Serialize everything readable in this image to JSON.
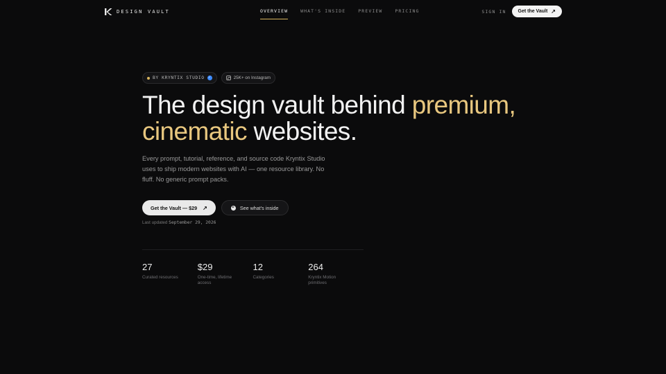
{
  "nav": {
    "brand": "DESIGN VAULT",
    "links": [
      "OVERVIEW",
      "WHAT'S INSIDE",
      "PREVIEW",
      "PRICING"
    ],
    "active_link": "OVERVIEW",
    "signin": "SIGN IN",
    "cta": "Get the Vault"
  },
  "hero": {
    "badge_studio": "BY KRYNTIX STUDIO",
    "badge_instagram": "25K+ on Instagram",
    "headline_part1": "The design vault behind ",
    "headline_gold1": "premium,",
    "headline_gold2": "cinematic",
    "headline_part2": " websites.",
    "description": "Every prompt, tutorial, reference, and source code Kryntix Studio uses to ship modern websites with AI — one resource library. No fluff. No generic prompt packs.",
    "primary_button": "Get the Vault — $29",
    "secondary_button": "See what's inside",
    "updated_label": "Last updated",
    "updated_date": "September 29, 2026"
  },
  "stats": [
    {
      "value": "27",
      "label": "Curated resources"
    },
    {
      "value": "$29",
      "label": "One-time, lifetime access"
    },
    {
      "value": "12",
      "label": "Categories"
    },
    {
      "value": "264",
      "label": "Kryntix Motion primitives"
    }
  ],
  "colors": {
    "background": "#0b0b0c",
    "accent_gold": "#e8c77f",
    "verified_blue": "#3d8bff"
  },
  "icons": [
    "brand-logo-icon",
    "arrow-up-right-icon",
    "verified-check-icon",
    "instagram-icon",
    "play-icon"
  ]
}
